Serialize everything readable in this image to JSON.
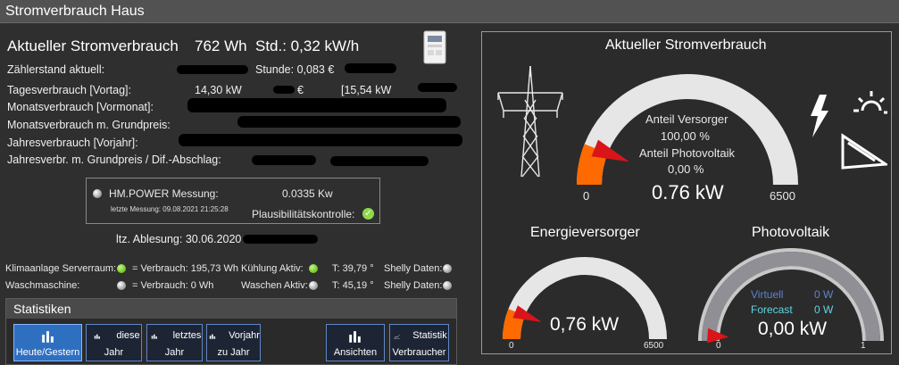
{
  "window": {
    "title": "Stromverbrauch Haus"
  },
  "current": {
    "label": "Aktueller Stromverbrauch",
    "value": "762 Wh",
    "std": "Std.: 0,32 kW/h"
  },
  "rows": [
    {
      "label": "Zählerstand aktuell:",
      "mid": "",
      "right": "Stunde: 0,083 €"
    },
    {
      "label": "Tagesverbrauch [Vortag]:",
      "mid": "14,30 kW",
      "right": "[15,54 kW"
    },
    {
      "label": "Monatsverbrauch [Vormonat]:",
      "mid": "",
      "right": ""
    },
    {
      "label": "Monatsverbrauch m. Grundpreis:",
      "mid": "",
      "right": ""
    },
    {
      "label": "Jahresverbrauch [Vorjahr]:",
      "mid": "",
      "right": ""
    },
    {
      "label": "Jahresverbr. m. Grundpreis / Dif.-Abschlag:",
      "mid": "",
      "right": ""
    }
  ],
  "euro_sign": "€",
  "meter": {
    "title": "HM.POWER Messung:",
    "value": "0.0335 Kw",
    "last": "letzte Messung: 09.08.2021 21:25:28",
    "plausi": "Plausibilitätskontrolle:"
  },
  "reading": "ltz. Ablesung: 30.06.2020",
  "devices": [
    {
      "name": "Klimaanlage Serverraum:",
      "consumption": "= Verbrauch: 195,73 Wh",
      "status_label": "Kühlung Aktiv:",
      "temp": "T: 39,79 °",
      "shelly": "Shelly Daten:"
    },
    {
      "name": "Waschmaschine:",
      "consumption": "= Verbrauch: 0 Wh",
      "status_label": "Waschen Aktiv:",
      "temp": "T: 45,19 °",
      "shelly": "Shelly Daten:"
    }
  ],
  "stats": {
    "title": "Statistiken",
    "buttons": [
      {
        "l1": "",
        "l2": "Heute/Gestern",
        "active": true
      },
      {
        "l1": "diese",
        "l2": "Jahr",
        "active": false
      },
      {
        "l1": "letztes",
        "l2": "Jahr",
        "active": false
      },
      {
        "l1": "Vorjahr",
        "l2": "zu Jahr",
        "active": false
      },
      {
        "l1": "",
        "l2": "Ansichten",
        "active": false
      },
      {
        "l1": "Statistik",
        "l2": "Verbraucher",
        "active": false
      }
    ]
  },
  "gauges": {
    "main": {
      "title": "Aktueller Stromverbrauch",
      "min": "0",
      "max": "6500",
      "value": "0.76 kW",
      "fill_fraction": 0.12,
      "anteil_versorger_label": "Anteil Versorger",
      "anteil_versorger": "100,00 %",
      "anteil_pv_label": "Anteil Photovoltaik",
      "anteil_pv": "0,00 %"
    },
    "energie": {
      "title": "Energieversorger",
      "min": "0",
      "max": "6500",
      "value": "0,76 kW",
      "fill_fraction": 0.12
    },
    "pv": {
      "title": "Photovoltaik",
      "min": "0",
      "max": "1",
      "value": "0,00 kW",
      "virtuell_label": "Virtuell",
      "virtuell_value": "0 W",
      "forecast_label": "Forecast",
      "forecast_value": "0 W",
      "fill_fraction": 0.0
    }
  },
  "colors": {
    "accent_orange": "#ff6a00",
    "needle_red": "#d9141b",
    "led_green": "#6cc51e",
    "button_blue": "#2f6fc0",
    "virtuell_blue": "#5b83d6",
    "forecast_cyan": "#62d3e0"
  }
}
